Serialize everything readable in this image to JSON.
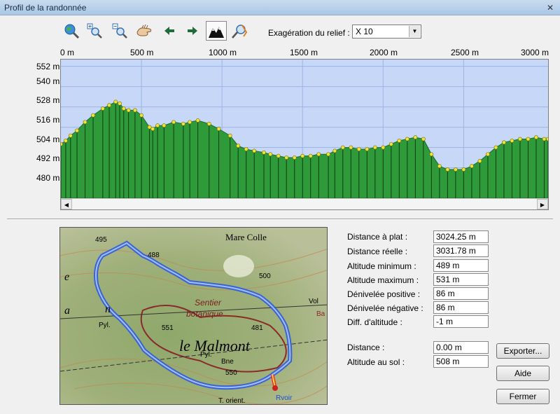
{
  "window": {
    "title": "Profil de la randonnée",
    "close": "✕"
  },
  "toolbar": {
    "exag_label": "Exagération du relief :",
    "exag_value": "X 10",
    "icons": [
      "globe-search-icon",
      "zoom-in-icon",
      "zoom-out-icon",
      "hand-pan-icon",
      "arrow-left-icon",
      "arrow-right-icon",
      "terrain-profile-icon",
      "route-tool-icon"
    ]
  },
  "profile": {
    "x_ticks": [
      "0 m",
      "500 m",
      "1000 m",
      "1500 m",
      "2000 m",
      "2500 m",
      "3000 m"
    ],
    "y_ticks": [
      "552 m",
      "540 m",
      "528 m",
      "516 m",
      "504 m",
      "492 m",
      "480 m"
    ],
    "colors": {
      "sky": "#c6d7f7",
      "terrain": "#2e9a3a",
      "grid": "#9db5e5",
      "point": "#f2e33a"
    }
  },
  "chart_data": {
    "type": "area",
    "title": "",
    "xlabel": "",
    "ylabel": "",
    "xlim": [
      0,
      3024
    ],
    "ylim": [
      474,
      556
    ],
    "grid": true,
    "series": [
      {
        "x": [
          0,
          30,
          60,
          100,
          150,
          200,
          260,
          300,
          340,
          365,
          390,
          420,
          460,
          500,
          550,
          570,
          600,
          640,
          700,
          760,
          800,
          850,
          920,
          980,
          1050,
          1100,
          1150,
          1200,
          1260,
          1300,
          1350,
          1400,
          1450,
          1500,
          1550,
          1600,
          1660,
          1700,
          1750,
          1800,
          1850,
          1900,
          1950,
          2000,
          2050,
          2100,
          2150,
          2200,
          2250,
          2300,
          2350,
          2400,
          2450,
          2500,
          2550,
          2600,
          2650,
          2700,
          2750,
          2800,
          2850,
          2900,
          2950,
          3000,
          3024
        ],
        "y": [
          506,
          508,
          511,
          514,
          519,
          523,
          527,
          529,
          531,
          530,
          527,
          526,
          526,
          523,
          516,
          515,
          517,
          517,
          519,
          518,
          519,
          520,
          518,
          515,
          511,
          505,
          503,
          502,
          501,
          500,
          499,
          498,
          498,
          499,
          499,
          500,
          500,
          502,
          504,
          504,
          503,
          503,
          504,
          504,
          506,
          508,
          509,
          510,
          509,
          500,
          493,
          491,
          491,
          491,
          493,
          496,
          500,
          504,
          507,
          508,
          509,
          509,
          510,
          509,
          509
        ]
      }
    ],
    "units": "m"
  },
  "stats": [
    {
      "label": "Distance à plat :",
      "value": "3024.25 m"
    },
    {
      "label": "Distance réelle :",
      "value": "3031.78 m"
    },
    {
      "label": "Altitude minimum :",
      "value": "489 m"
    },
    {
      "label": "Altitude maximum :",
      "value": "531 m"
    },
    {
      "label": "Dénivelée positive :",
      "value": "86 m"
    },
    {
      "label": "Dénivelée négative :",
      "value": "86 m"
    },
    {
      "label": "Diff. d'altitude :",
      "value": "-1 m"
    }
  ],
  "cursor": {
    "distance_label": "Distance :",
    "distance_value": "0.00 m",
    "alt_label": "Altitude au sol :",
    "alt_value": "508 m"
  },
  "buttons": {
    "export": "Exporter...",
    "help": "Aide",
    "close": "Fermer"
  },
  "map": {
    "labels": [
      "495",
      "488",
      "Mare Colle",
      "500",
      "Sentier",
      "botanique",
      "481",
      "551",
      "le Malmont",
      "Pyl.",
      "Pyl.",
      "Bne",
      "550",
      "T. orient.",
      "Rvoir",
      "a",
      "n",
      "e",
      "Vol",
      "Ba"
    ]
  }
}
